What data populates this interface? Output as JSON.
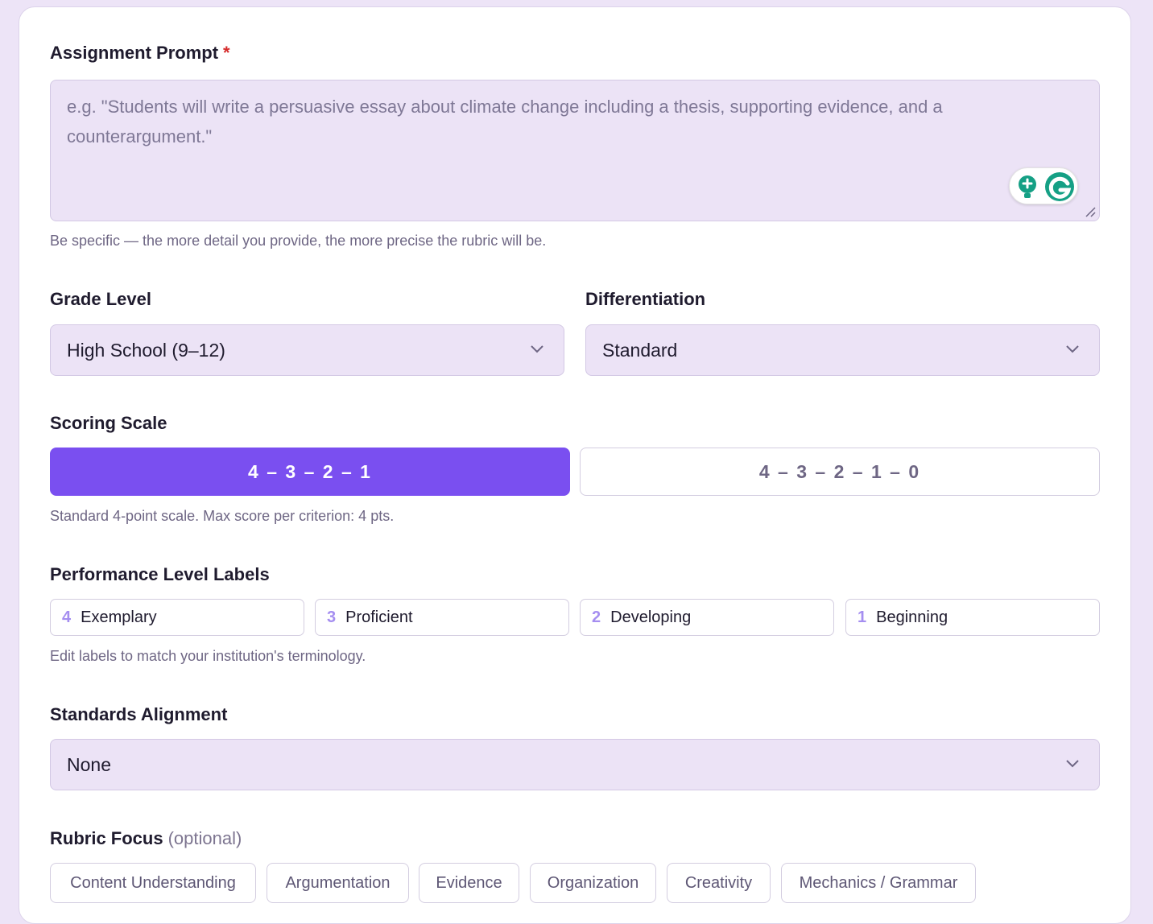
{
  "prompt": {
    "label": "Assignment Prompt",
    "required_mark": "*",
    "placeholder": "e.g. \"Students will write a persuasive essay about climate change including a thesis, supporting evidence, and a counterargument.\"",
    "value": "",
    "hint": "Be specific — the more detail you provide, the more precise the rubric will be."
  },
  "grade_level": {
    "label": "Grade Level",
    "selected": "High School (9–12)"
  },
  "differentiation": {
    "label": "Differentiation",
    "selected": "Standard"
  },
  "scoring_scale": {
    "label": "Scoring Scale",
    "options": [
      "4 – 3 – 2 – 1",
      "4 – 3 – 2 – 1 – 0"
    ],
    "selected_index": 0,
    "hint": "Standard 4-point scale. Max score per criterion: 4 pts."
  },
  "performance_levels": {
    "label": "Performance Level Labels",
    "items": [
      {
        "num": "4",
        "label": "Exemplary"
      },
      {
        "num": "3",
        "label": "Proficient"
      },
      {
        "num": "2",
        "label": "Developing"
      },
      {
        "num": "1",
        "label": "Beginning"
      }
    ],
    "hint": "Edit labels to match your institution's terminology."
  },
  "standards": {
    "label": "Standards Alignment",
    "selected": "None"
  },
  "rubric_focus": {
    "label": "Rubric Focus",
    "optional_label": "(optional)",
    "chips": [
      "Content Understanding",
      "Argumentation",
      "Evidence",
      "Organization",
      "Creativity",
      "Mechanics / Grammar"
    ]
  },
  "colors": {
    "accent": "#7a4ff0",
    "field_bg": "#ece3f6",
    "page_bg": "#ede4f7",
    "required": "#d62b2b",
    "grammarly": "#15a085"
  },
  "icons": [
    "chevron-down-icon",
    "resize-handle-icon",
    "grammarly-icon",
    "lightbulb-icon"
  ]
}
